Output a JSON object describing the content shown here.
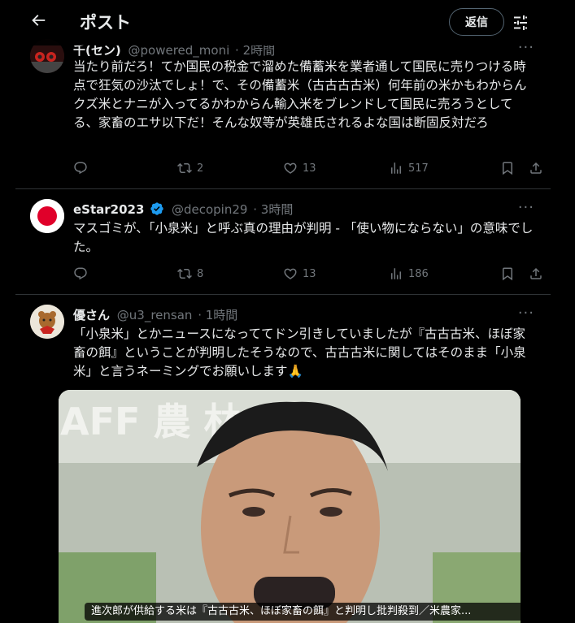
{
  "header": {
    "title": "ポスト",
    "reply_label": "返信"
  },
  "tweets": [
    {
      "name": "千(セン)",
      "handle": "@powered_moni",
      "time": "· 2時間",
      "text": "当たり前だろ！てか国民の税金で溜めた備蓄米を業者通して国民に売りつける時点で狂気の沙汰でしょ！で、その備蓄米（古古古古米）何年前の米かもわからんクズ米とナニが入ってるかわからん輸入米をブレンドして国民に売ろうとしてる、家畜のエサ以下だ！そんな奴等が英雄氏されるよな国は断固反対だろ",
      "replies": "",
      "reposts": "2",
      "likes": "13",
      "views": "517"
    },
    {
      "name": "eStar2023",
      "handle": "@decopin29",
      "time": "· 3時間",
      "text": "マスゴミが、「小泉米」と呼ぶ真の理由が判明 - 「使い物にならない」の意味でした。",
      "replies": "",
      "reposts": "8",
      "likes": "13",
      "views": "186"
    },
    {
      "name": "優さん",
      "handle": "@u3_rensan",
      "time": "· 1時間",
      "text": "「小泉米」とかニュースになっててドン引きしていましたが『古古古米、ほぼ家畜の餌』ということが判明したそうなので、古古古米に関してはそのまま「小泉米」と言うネーミングでお願いします🙏",
      "media_caption": "進次郎が供給する米は『古古古米、ほぼ家畜の餌』と判明し批判殺到／米農家...",
      "media_sign_text": "AFF 農 林 水"
    }
  ],
  "colors": {
    "background": "#000000",
    "text": "#e7e9ea",
    "muted": "#71767b",
    "border": "#2f3336",
    "verified": "#1d9bf0"
  }
}
